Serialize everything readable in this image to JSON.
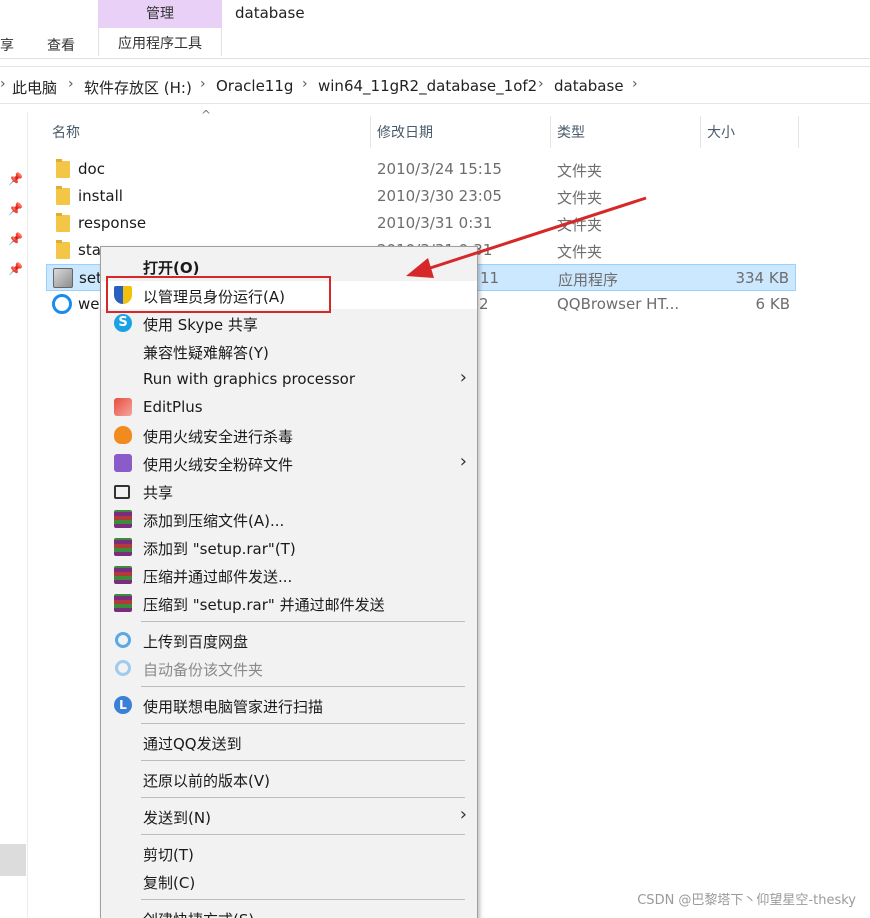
{
  "ribbon": {
    "context_header": "管理",
    "context_folder": "database",
    "tab_share_partial": "享",
    "tab_view": "查看",
    "tab_app_tools": "应用程序工具"
  },
  "breadcrumb": [
    "此电脑",
    "软件存放区 (H:)",
    "Oracle11g",
    "win64_11gR2_database_1of2",
    "database"
  ],
  "breadcrumb_sep": "›",
  "columns": {
    "name": "名称",
    "date": "修改日期",
    "type": "类型",
    "size": "大小"
  },
  "files": [
    {
      "name": "doc",
      "date": "2010/3/24 15:15",
      "type": "文件夹",
      "size": "",
      "icon": "folder-icon"
    },
    {
      "name": "install",
      "date": "2010/3/30 23:05",
      "type": "文件夹",
      "size": "",
      "icon": "folder-icon"
    },
    {
      "name": "response",
      "date": "2010/3/31 0:31",
      "type": "文件夹",
      "size": "",
      "icon": "folder-icon"
    },
    {
      "name": "sta",
      "date": "2010/3/31 0:31",
      "type": "文件夹",
      "size": "",
      "icon": "folder-icon"
    },
    {
      "name": "set",
      "date": "11",
      "type": "应用程序",
      "size": "334 KB",
      "icon": "app-icon"
    },
    {
      "name": "we",
      "date": "2",
      "type": "QQBrowser HT...",
      "size": "6 KB",
      "icon": "qqbrowser-icon"
    }
  ],
  "context_menu": {
    "open": "打开(O)",
    "run_as_admin": "以管理员身份运行(A)",
    "skype_share": "使用 Skype 共享",
    "compat": "兼容性疑难解答(Y)",
    "run_gpu": "Run with graphics processor",
    "editplus": "EditPlus",
    "huorong_scan": "使用火绒安全进行杀毒",
    "huorong_shred": "使用火绒安全粉碎文件",
    "share": "共享",
    "add_archive": "添加到压缩文件(A)...",
    "add_setup_rar": "添加到 \"setup.rar\"(T)",
    "compress_email": "压缩并通过邮件发送...",
    "compress_setup_email": "压缩到 \"setup.rar\" 并通过邮件发送",
    "upload_baidu": "上传到百度网盘",
    "auto_backup": "自动备份该文件夹",
    "lenovo_scan": "使用联想电脑管家进行扫描",
    "send_qq": "通过QQ发送到",
    "restore_prev": "还原以前的版本(V)",
    "send_to": "发送到(N)",
    "cut": "剪切(T)",
    "copy": "复制(C)",
    "create_shortcut": "创建快捷方式(S)"
  },
  "submenu_glyph": "›",
  "skype_glyph": "S",
  "lenovo_glyph": "L",
  "pin_glyph": "📌",
  "sort_glyph": "^",
  "watermark": "CSDN @巴黎塔下丶仰望星空-thesky",
  "colors": {
    "accent_red": "#d62828",
    "selection": "#cce8ff",
    "context_tab": "#e8d0f7"
  }
}
